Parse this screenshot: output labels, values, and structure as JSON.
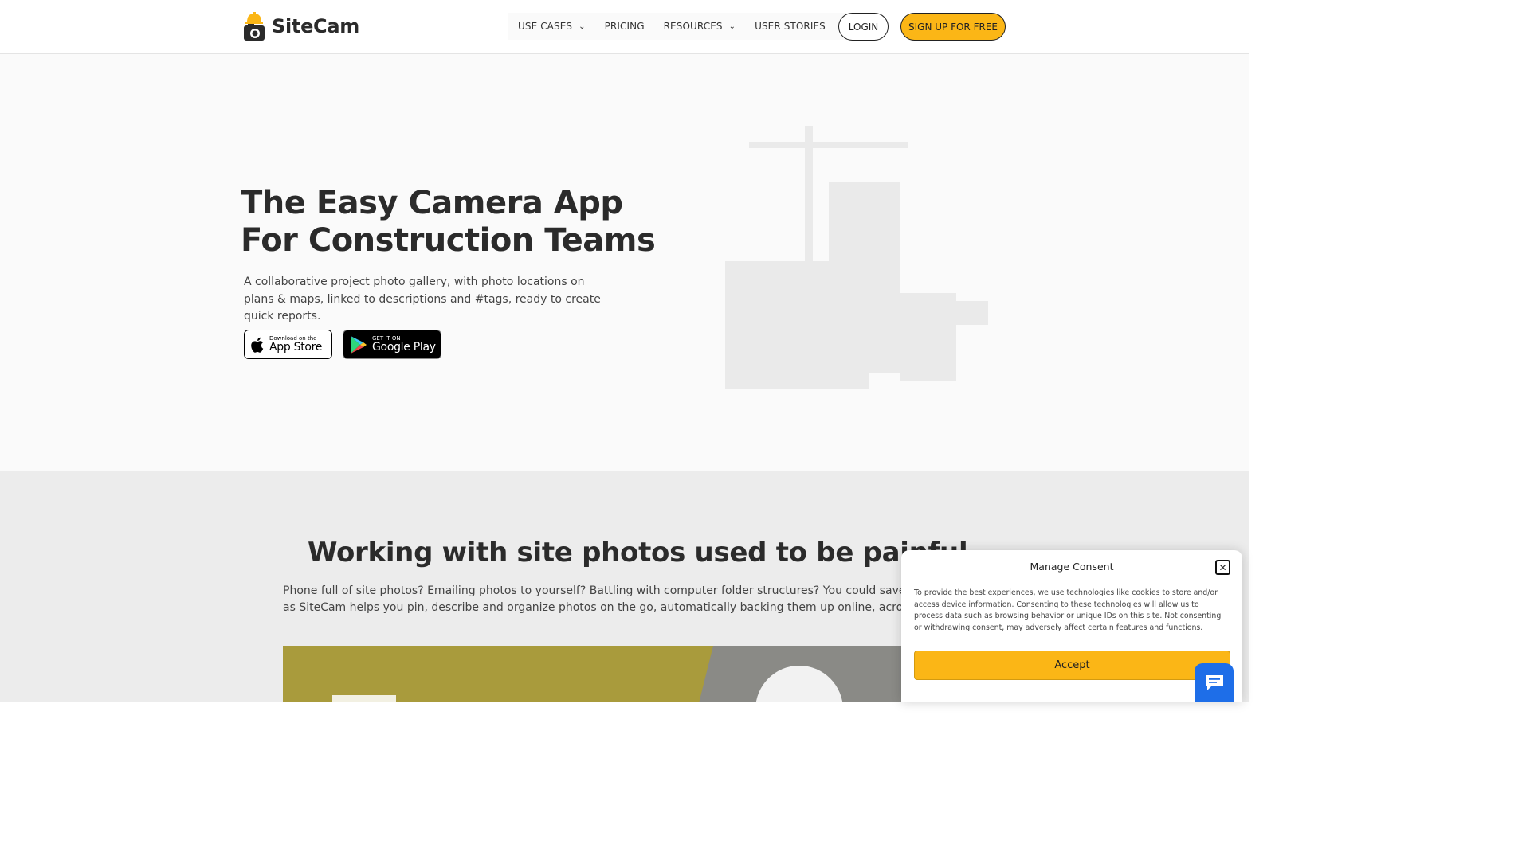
{
  "header": {
    "logo_text": "SiteCam",
    "nav": [
      {
        "label": "USE CASES",
        "has_dropdown": true
      },
      {
        "label": "PRICING",
        "has_dropdown": false
      },
      {
        "label": "RESOURCES",
        "has_dropdown": true
      },
      {
        "label": "USER STORIES",
        "has_dropdown": false
      }
    ],
    "login_label": "LOGIN",
    "signup_label": "SIGN UP FOR FREE"
  },
  "hero": {
    "title_line1": "The Easy Camera App",
    "title_line2": "For Construction Teams",
    "description": "A collaborative project photo gallery, with photo locations on plans & maps, linked to descriptions and #tags, ready to create quick reports.",
    "appstore": {
      "small": "Download on the",
      "big": "App Store"
    },
    "googleplay": {
      "small": "GET IT ON",
      "big": "Google Play"
    }
  },
  "section2": {
    "title": "Working with site photos used to be painful",
    "desc_line1": "Phone full of site photos? Emailing photos to yourself? Battling with computer folder structures? You could save hours of a",
    "desc_line2": "as SiteCam helps you pin, describe and organize photos on the go, automatically backing them up online, across your who"
  },
  "consent": {
    "title": "Manage Consent",
    "text": "To provide the best experiences, we use technologies like cookies to store and/or access device information. Consenting to these technologies will allow us to process data such as browsing behavior or unique IDs on this site. Not consenting or withdrawing consent, may adversely affect certain features and functions.",
    "accept_label": "Accept",
    "close_glyph": "✕"
  },
  "colors": {
    "accent": "#fbb616",
    "chat": "#1e6ee8",
    "hero_bg": "#fafafa",
    "section_bg": "#ececec"
  },
  "icons": [
    "hardhat-camera-logo-icon",
    "chevron-down-icon",
    "apple-icon",
    "google-play-icon",
    "close-icon",
    "chat-icon"
  ]
}
